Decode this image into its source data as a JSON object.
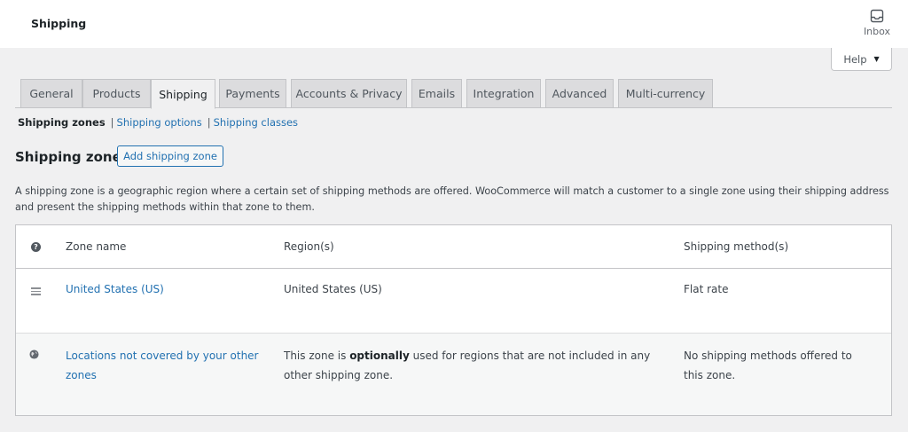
{
  "header": {
    "title": "Shipping",
    "inbox_label": "Inbox"
  },
  "help_button": {
    "label": "Help",
    "caret": "▼"
  },
  "tabs": [
    {
      "label": "General"
    },
    {
      "label": "Products"
    },
    {
      "label": "Shipping",
      "active": true
    },
    {
      "label": "Payments"
    },
    {
      "label": "Accounts & Privacy"
    },
    {
      "label": "Emails"
    },
    {
      "label": "Integration"
    },
    {
      "label": "Advanced"
    },
    {
      "label": "Multi-currency"
    }
  ],
  "subnav": {
    "current": "Shipping zones",
    "separator": "|",
    "links": [
      "Shipping options",
      "Shipping classes"
    ]
  },
  "zones": {
    "heading": "Shipping zones",
    "add_button": "Add shipping zone",
    "description": "A shipping zone is a geographic region where a certain set of shipping methods are offered. WooCommerce will match a customer to a single zone using their shipping address and present the shipping methods within that zone to them."
  },
  "table": {
    "help_glyph": "?",
    "columns": [
      "Zone name",
      "Region(s)",
      "Shipping method(s)"
    ],
    "rows": [
      {
        "zone_name": "United States (US)",
        "regions": "United States (US)",
        "methods": "Flat rate"
      }
    ],
    "fallback_row": {
      "zone_name": "Locations not covered by your other zones",
      "regions_prefix": "This zone is ",
      "regions_bold": "optionally",
      "regions_suffix": " used for regions that are not included in any other shipping zone.",
      "methods": "No shipping methods offered to this zone."
    }
  },
  "icons": {
    "inbox": "inbox-icon",
    "help": "help-circle-icon",
    "drag": "drag-handle-icon",
    "globe": "globe-icon"
  },
  "colors": {
    "link": "#2271b1",
    "background": "#f0f0f1",
    "text": "#1d2327"
  }
}
